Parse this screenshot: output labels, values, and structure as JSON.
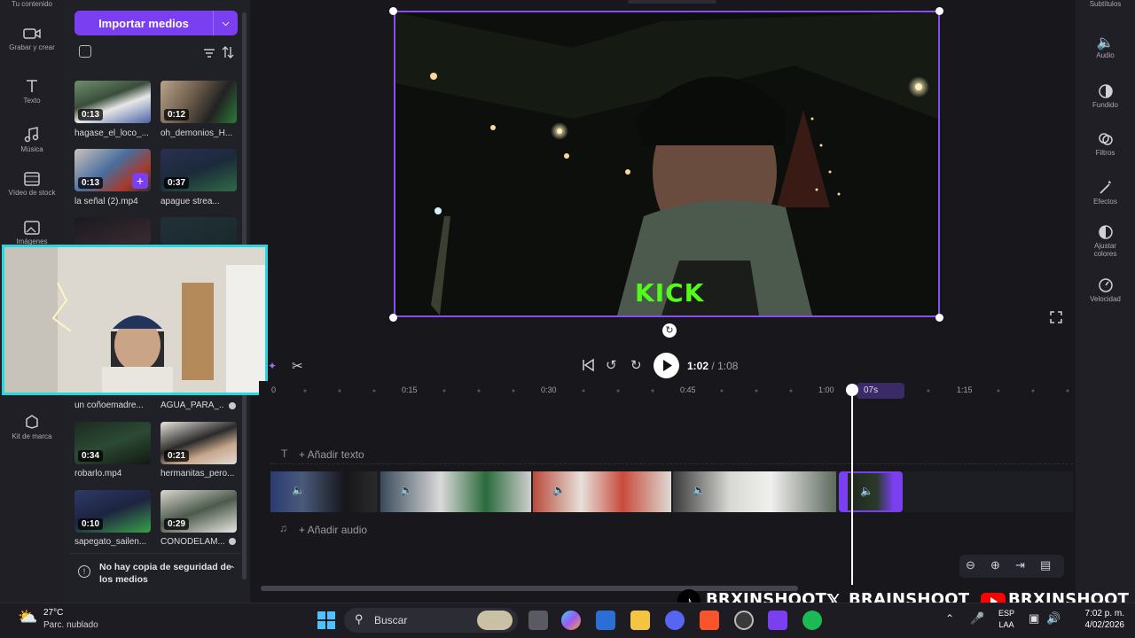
{
  "rail": {
    "top_label": "Tu contenido",
    "items": [
      {
        "label": "Grabar y crear"
      },
      {
        "label": "Texto"
      },
      {
        "label": "Música"
      },
      {
        "label": "Vídeo de stock"
      },
      {
        "label": "Imágenes"
      },
      {
        "label": "Kit de marca"
      }
    ]
  },
  "media": {
    "import_label": "Importar medios",
    "items": [
      {
        "duration": "0:13",
        "name": "hagase_el_loco_..."
      },
      {
        "duration": "0:12",
        "name": "oh_demonios_H..."
      },
      {
        "duration": "0:13",
        "name": "la señal (2).mp4"
      },
      {
        "duration": "0:37",
        "name": "apague strea..."
      },
      {
        "duration": "",
        "name": "un coñoemadre..."
      },
      {
        "duration": "",
        "name": "AGUA_PARA_..."
      },
      {
        "duration": "0:34",
        "name": "robarlo.mp4"
      },
      {
        "duration": "0:21",
        "name": "hermanitas_pero..."
      },
      {
        "duration": "0:10",
        "name": "sapegato_sailen..."
      },
      {
        "duration": "0:29",
        "name": "CONODELAM..."
      }
    ],
    "backup_notice": "No hay copia de seguridad de los medios"
  },
  "preview": {
    "overlay_text": "KICK"
  },
  "right_rail": {
    "top_label": "Subtítulos",
    "items": [
      {
        "label": "Audio"
      },
      {
        "label": "Fundido"
      },
      {
        "label": "Filtros"
      },
      {
        "label": "Efectos"
      },
      {
        "label": "Ajustar colores"
      },
      {
        "label": "Velocidad"
      }
    ]
  },
  "playback": {
    "current_time": "1:02",
    "separator": "/",
    "total_time": "1:08"
  },
  "timeline": {
    "ticks": [
      "0",
      "0:15",
      "0:30",
      "0:45",
      "1:00",
      "1:15"
    ],
    "playhead_label": "07s",
    "add_text": "+ Añadir texto",
    "add_audio": "+ Añadir audio"
  },
  "watermarks": {
    "tiktok": "BRXINSHOOT",
    "x": "BRAINSHOOT_",
    "youtube": "BRXINSHOOT"
  },
  "taskbar": {
    "weather_temp": "27°C",
    "weather_desc": "Parc. nublado",
    "search_label": "Buscar",
    "lang_top": "ESP",
    "lang_bottom": "LAA",
    "time": "7:02 p. m.",
    "date": "4/02/2026"
  },
  "colors": {
    "accent": "#7b3ff2",
    "webcam_border": "#27d7e0",
    "kick_green": "#53fc18"
  }
}
